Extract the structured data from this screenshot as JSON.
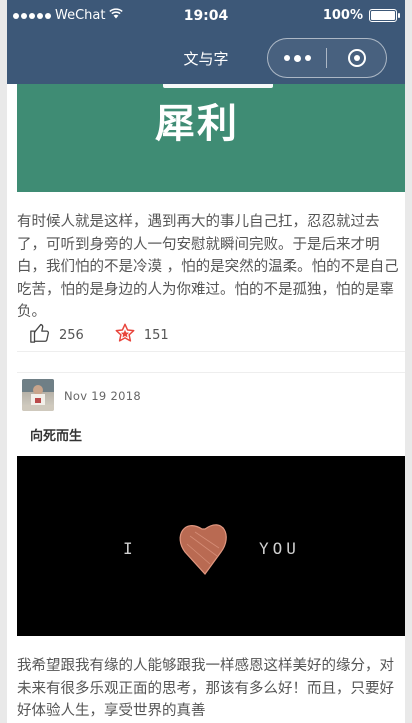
{
  "status_bar": {
    "carrier": "WeChat",
    "time": "19:04",
    "battery": "100%"
  },
  "nav": {
    "title": "文与字"
  },
  "posts": [
    {
      "image_text": "犀利",
      "text": "有时候人就是这样，遇到再大的事儿自己扛，忍忍就过去了，可听到身旁的人一句安慰就瞬间完败。于是后来才明白，我们怕的不是冷漠 ，怕的是突然的温柔。怕的不是自己吃苦，怕的是身边的人为你难过。怕的不是孤独，怕的是辜负。",
      "likes": "256",
      "favorites": "151"
    },
    {
      "date": "Nov 19 2018",
      "title": "向死而生",
      "image_text_left": "I",
      "image_text_right": "YOU",
      "text": "我希望跟我有缘的人能够跟我一样感恩这样美好的缘分，对未来有很多乐观正面的思考，那该有多么好！而且，只要好好体验人生，享受世界的真善"
    }
  ],
  "colors": {
    "nav_bg": "#3d5878",
    "post1_bg": "#3f8c74",
    "star": "#e8453c"
  }
}
